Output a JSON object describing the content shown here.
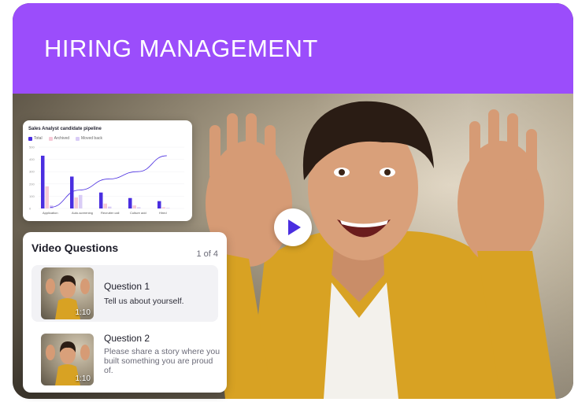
{
  "header": {
    "title": "HIRING MANAGEMENT"
  },
  "colors": {
    "brand": "#9b4dfb",
    "bar_total": "#4a2ee0",
    "bar_archived": "#f6c9d6",
    "bar_moved_back": "#d9ccf6"
  },
  "video": {
    "play_icon": "play-icon"
  },
  "pipeline_card": {
    "title": "Sales Analyst candidate pipeline",
    "legend": [
      "Total",
      "Archived",
      "Moved back"
    ],
    "chart_data": {
      "type": "bar",
      "title": "Sales Analyst candidate pipeline",
      "categories": [
        "Application",
        "Auto-screening",
        "Recruiter call",
        "Culture add",
        "Hired"
      ],
      "y_ticks": [
        "0",
        "100",
        "200",
        "300",
        "400",
        "500"
      ],
      "ylim": [
        0,
        500
      ],
      "series": [
        {
          "name": "Total",
          "values": [
            430,
            260,
            130,
            85,
            60
          ]
        },
        {
          "name": "Archived",
          "values": [
            180,
            90,
            40,
            25,
            10
          ]
        },
        {
          "name": "Moved back",
          "values": [
            25,
            110,
            15,
            10,
            5
          ]
        }
      ],
      "trend_line": [
        10,
        150,
        240,
        300,
        430
      ],
      "legend_position": "top-left"
    }
  },
  "video_questions": {
    "title": "Video Questions",
    "counter": "1 of 4",
    "items": [
      {
        "title": "Question 1",
        "text": "Tell us about yourself.",
        "duration": "1:10"
      },
      {
        "title": "Question 2",
        "text": "Please share a story where you built something you are proud of.",
        "duration": "1:10"
      }
    ]
  }
}
